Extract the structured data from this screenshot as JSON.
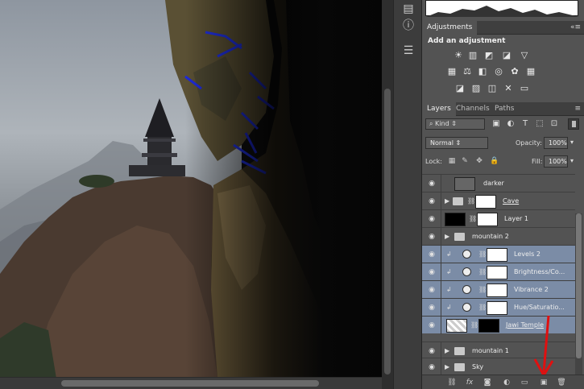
{
  "adjustments": {
    "tab": "Adjustments",
    "title": "Add an adjustment",
    "row1": [
      "brightness-icon",
      "levels-icon",
      "curves-icon",
      "exposure-icon",
      "gradient-triangle-icon"
    ],
    "row2": [
      "vibrance-icon",
      "balance-icon",
      "bw-icon",
      "photo-filter-icon",
      "mixer-icon",
      "lookup-icon"
    ],
    "row3": [
      "invert-icon",
      "posterize-icon",
      "threshold-icon",
      "selective-color-icon",
      "gradient-map-icon"
    ]
  },
  "layers_panel": {
    "tabs": [
      "Layers",
      "Channels",
      "Paths"
    ],
    "filter_label": "Kind",
    "blend_mode": "Normal",
    "opacity_label": "Opacity:",
    "opacity_value": "100%",
    "lock_label": "Lock:",
    "fill_label": "Fill:",
    "fill_value": "100%",
    "layers": [
      {
        "name": "darker"
      },
      {
        "name": "Cave"
      },
      {
        "name": "Layer 1"
      },
      {
        "name": "mountain 2"
      },
      {
        "name": "Levels 2"
      },
      {
        "name": "Brightness/Co..."
      },
      {
        "name": "Vibrance 2"
      },
      {
        "name": "Hue/Saturatio..."
      },
      {
        "name": "Jawi Temple"
      },
      {
        "name": "mountain 1"
      },
      {
        "name": "Sky"
      }
    ]
  },
  "bottom_icons": [
    "link-icon",
    "fx-icon",
    "mask-icon",
    "adjustment-icon",
    "folder-icon",
    "new-layer-icon",
    "trash-icon"
  ],
  "tool_icons": [
    "info-icon-top",
    "info-icon",
    "align-icon"
  ],
  "colors": {
    "selection": "#7b8ca6",
    "panel": "#535353",
    "annotation_arrow": "#e01010"
  }
}
